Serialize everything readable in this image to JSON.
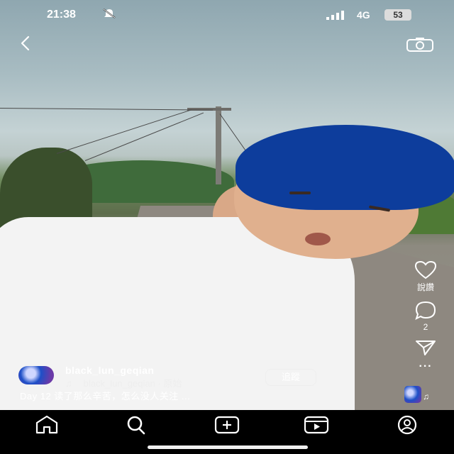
{
  "status_bar": {
    "time": "21:38",
    "mute_icon": "bell-off-icon",
    "signal_icon": "signal-bars-icon",
    "network": "4G",
    "battery": "53"
  },
  "top_bar": {
    "back_icon": "chevron-left-icon",
    "camera_icon": "camera-icon"
  },
  "actions": {
    "like_icon": "heart-icon",
    "like_label": "說讚",
    "comment_icon": "comment-icon",
    "comment_count": "2",
    "share_icon": "send-icon",
    "more_icon": "more-icon",
    "more_label": "···"
  },
  "post": {
    "username": "black_lun_geqian",
    "music_note": "♫",
    "audio_text": "black_lun_geqian · 原始",
    "follow_label": "追蹤",
    "caption": "Day 12 读了那么辛苦，怎么没人关注 ..."
  },
  "navbar": {
    "items": [
      {
        "icon": "home-icon"
      },
      {
        "icon": "search-icon"
      },
      {
        "icon": "create-icon"
      },
      {
        "icon": "reels-icon"
      },
      {
        "icon": "profile-icon"
      }
    ]
  },
  "colors": {
    "hair": "#0d3d9c",
    "shirt": "#f3f3f3",
    "navbar": "#000000",
    "text": "#ffffff"
  }
}
